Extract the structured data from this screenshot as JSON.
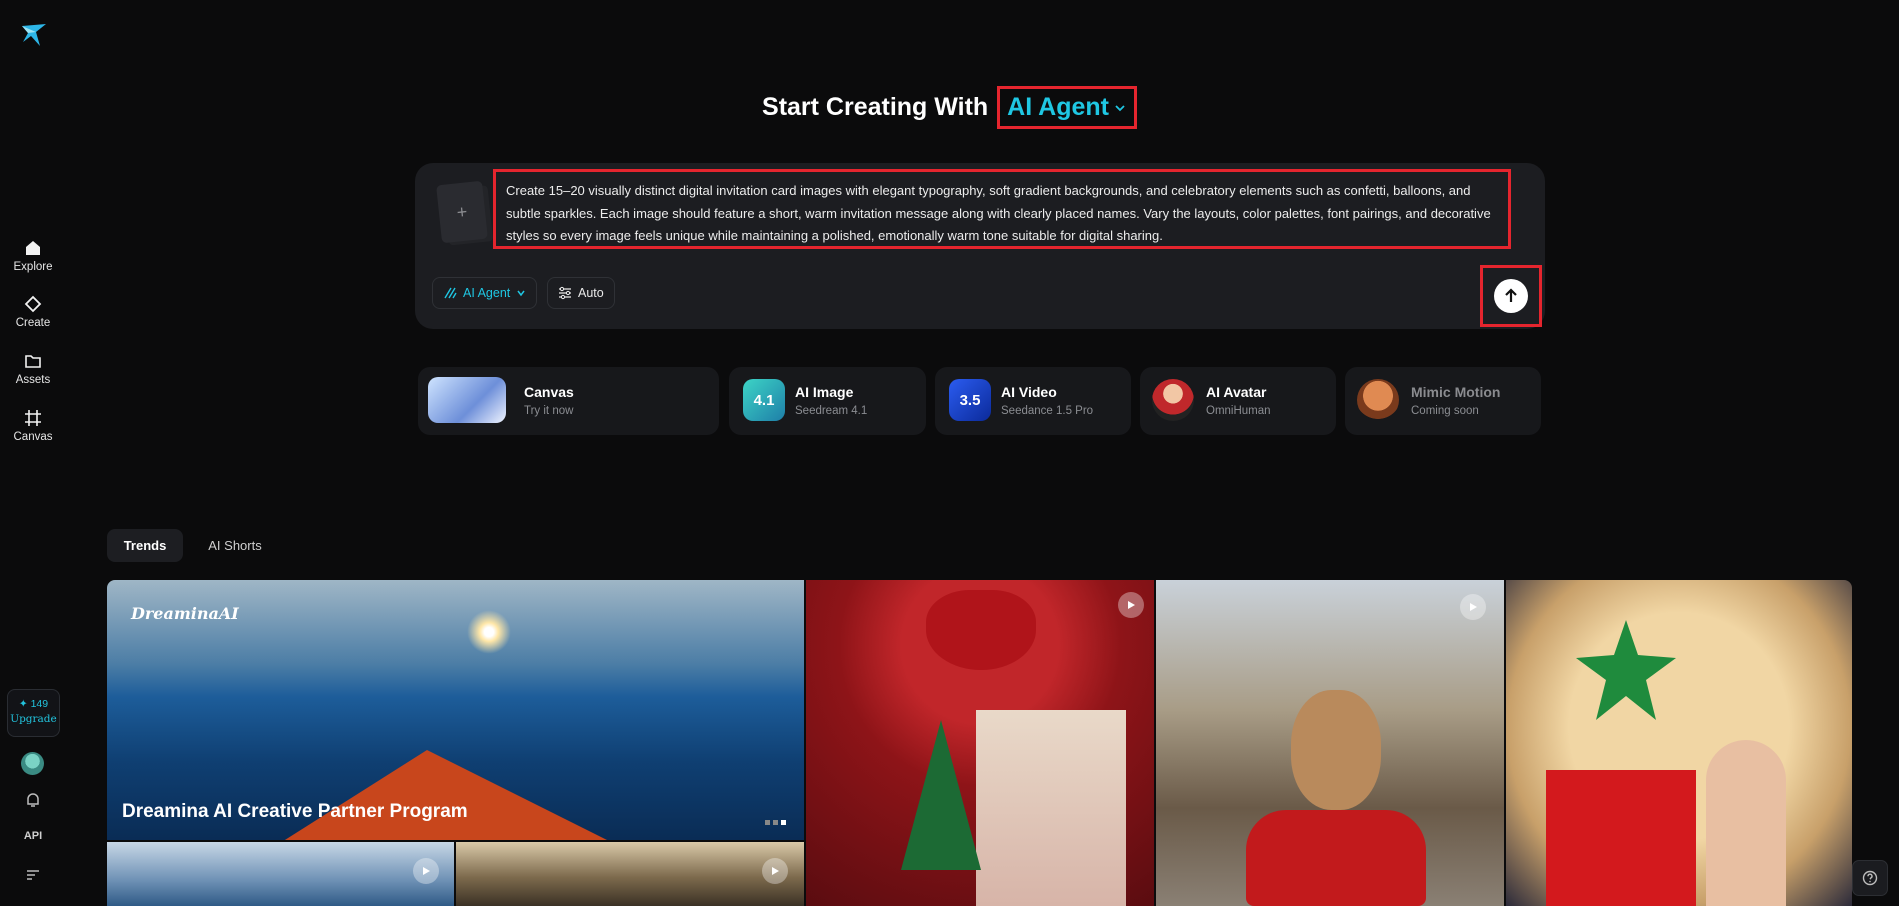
{
  "sidebar": {
    "items": [
      {
        "label": "Explore",
        "icon": "home-icon"
      },
      {
        "label": "Create",
        "icon": "diamond-icon"
      },
      {
        "label": "Assets",
        "icon": "folder-icon"
      },
      {
        "label": "Canvas",
        "icon": "canvas-icon"
      }
    ],
    "credits": {
      "count": "✦ 149",
      "upgrade": "Upgrade"
    },
    "api_label": "API"
  },
  "headline": {
    "prefix": "Start Creating With",
    "mode": "AI Agent"
  },
  "prompt": {
    "text": "Create 15–20 visually distinct digital invitation card images with elegant typography, soft gradient backgrounds, and celebratory elements such as confetti, balloons, and subtle sparkles. Each image should feature a short, warm invitation message along with clearly placed names. Vary the layouts, color palettes, font pairings, and decorative styles so every image feels unique while maintaining a polished, emotionally warm tone suitable for digital sharing.",
    "add_symbol": "+",
    "mode_chip": "AI Agent",
    "settings_chip": "Auto"
  },
  "tools": [
    {
      "title": "Canvas",
      "subtitle": "Try it now"
    },
    {
      "title": "AI Image",
      "subtitle": "Seedream 4.1",
      "badge": "4.1"
    },
    {
      "title": "AI Video",
      "subtitle": "Seedance 1.5 Pro",
      "badge": "3.5"
    },
    {
      "title": "AI Avatar",
      "subtitle": "OmniHuman"
    },
    {
      "title": "Mimic Motion",
      "subtitle": "Coming soon"
    }
  ],
  "tabs": [
    {
      "label": "Trends",
      "active": true
    },
    {
      "label": "AI Shorts",
      "active": false
    }
  ],
  "gallery": {
    "banner_logo": "DreaminaAI",
    "banner_title": "Dreamina AI Creative Partner Program"
  },
  "colors": {
    "accent": "#1fc7e3",
    "highlight": "#e5252e",
    "background": "#0b0b0c"
  }
}
